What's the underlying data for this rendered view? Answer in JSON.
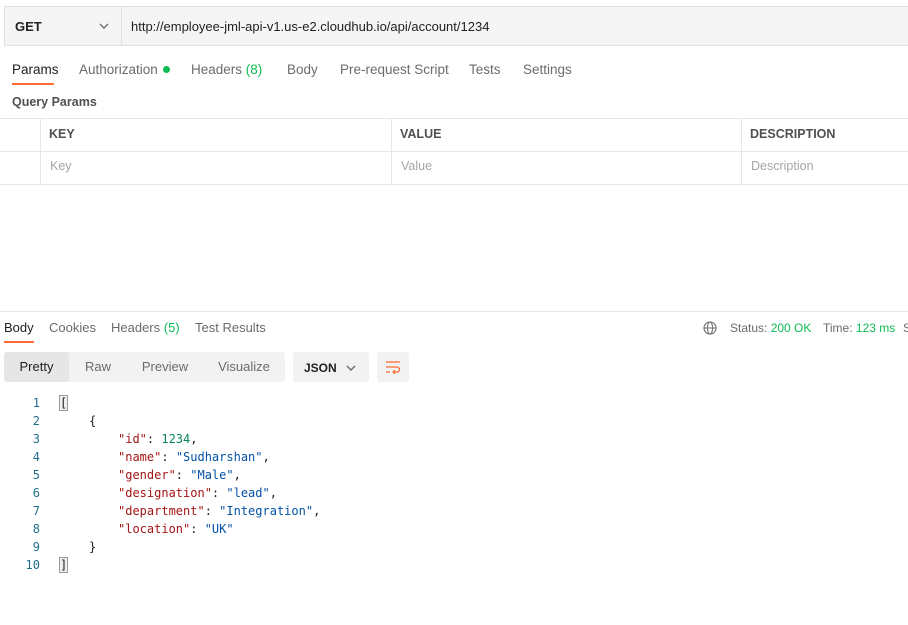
{
  "request": {
    "method": "GET",
    "url": "http://employee-jml-api-v1.us-e2.cloudhub.io/api/account/1234"
  },
  "request_tabs": {
    "params": "Params",
    "authorization": "Authorization",
    "headers": "Headers",
    "headers_count": "(8)",
    "body": "Body",
    "pre_request": "Pre-request Script",
    "tests": "Tests",
    "settings": "Settings"
  },
  "query_params": {
    "title": "Query Params",
    "columns": [
      "KEY",
      "VALUE",
      "DESCRIPTION"
    ],
    "placeholders": [
      "Key",
      "Value",
      "Description"
    ]
  },
  "response_tabs": {
    "body": "Body",
    "cookies": "Cookies",
    "headers": "Headers",
    "headers_count": "(5)",
    "test_results": "Test Results"
  },
  "status": {
    "status_label": "Status:",
    "status_value": "200 OK",
    "time_label": "Time:",
    "time_value": "123 ms",
    "size_label": "S"
  },
  "format": {
    "modes": [
      "Pretty",
      "Raw",
      "Preview",
      "Visualize"
    ],
    "active": "Pretty",
    "language": "JSON"
  },
  "response_body": {
    "line_numbers": [
      "1",
      "2",
      "3",
      "4",
      "5",
      "6",
      "7",
      "8",
      "9",
      "10"
    ],
    "open_array": "[",
    "open_obj": "{",
    "close_obj": "}",
    "close_array": "]",
    "fields": [
      {
        "key": "\"id\"",
        "value": "1234",
        "type": "number",
        "sep": ","
      },
      {
        "key": "\"name\"",
        "value": "\"Sudharshan\"",
        "type": "string",
        "sep": ","
      },
      {
        "key": "\"gender\"",
        "value": "\"Male\"",
        "type": "string",
        "sep": ","
      },
      {
        "key": "\"designation\"",
        "value": "\"lead\"",
        "type": "string",
        "sep": ","
      },
      {
        "key": "\"department\"",
        "value": "\"Integration\"",
        "type": "string",
        "sep": ","
      },
      {
        "key": "\"location\"",
        "value": "\"UK\"",
        "type": "string",
        "sep": ""
      }
    ]
  },
  "colors": {
    "accent": "#ff6c37",
    "success": "#0cbb52"
  }
}
